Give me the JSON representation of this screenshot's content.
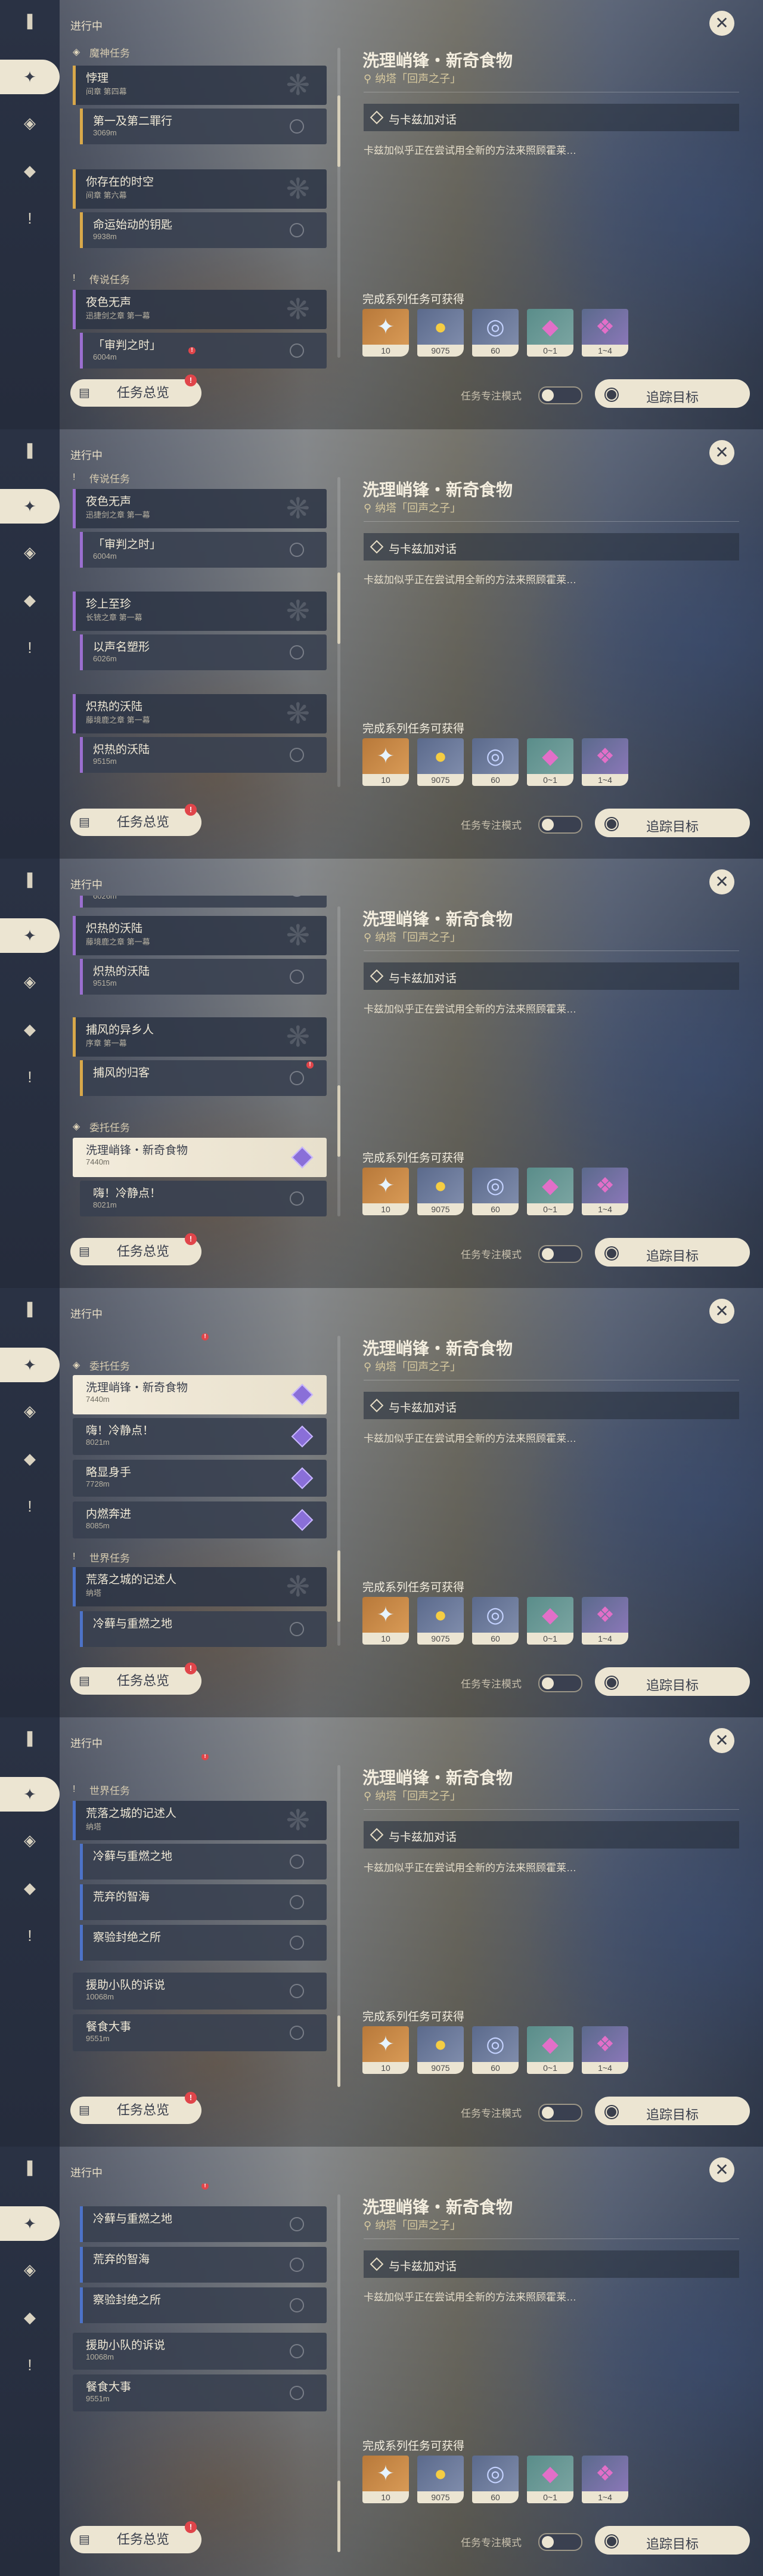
{
  "header": {
    "progress": "进行中"
  },
  "nav": {
    "icons": [
      "quest-book-icon",
      "elemental-diamond-icon",
      "inner-diamond-icon",
      "commission-diamond-icon",
      "exclamation-icon"
    ]
  },
  "categories": {
    "archon": "魔神任务",
    "story": "传说任务",
    "commission": "委托任务",
    "world": "世界任务"
  },
  "quests": {
    "q1": {
      "title": "悖理",
      "sub": "间章 第四幕"
    },
    "q2": {
      "title": "第一及第二罪行",
      "sub": "3069m"
    },
    "q3": {
      "title": "你存在的时空",
      "sub": "间章 第六幕"
    },
    "q4": {
      "title": "命运始动的钥匙",
      "sub": "9938m"
    },
    "q5": {
      "title": "夜色无声",
      "sub": "迅捷剑之章 第一幕"
    },
    "q6": {
      "title": "「审判之时」",
      "sub": "6004m"
    },
    "q7": {
      "title": "珍上至珍",
      "sub": "长铳之章 第一幕"
    },
    "q8": {
      "title": "以声名塑形",
      "sub": "6026m"
    },
    "q9": {
      "title": "炽热的沃陆",
      "sub": "藤境鹿之章 第一幕"
    },
    "q10": {
      "title": "炽热的沃陆",
      "sub": "9515m"
    },
    "q11": {
      "title": "捕风的异乡人",
      "sub": "序章 第一幕"
    },
    "q12": {
      "title": "捕风的归客",
      "sub": ""
    },
    "q13": {
      "title": "洗理峭锋・新奇食物",
      "sub": "7440m"
    },
    "q14": {
      "title": "嗨！冷静点！",
      "sub": "8021m"
    },
    "q15": {
      "title": "略显身手",
      "sub": "7728m"
    },
    "q16": {
      "title": "内燃奔进",
      "sub": "8085m"
    },
    "q17": {
      "title": "荒落之城的记述人",
      "sub": "纳塔"
    },
    "q18": {
      "title": "冷藓与重燃之地",
      "sub": ""
    },
    "q19": {
      "title": "荒弃的智海",
      "sub": ""
    },
    "q20": {
      "title": "察验封绝之所",
      "sub": ""
    },
    "q21": {
      "title": "援助小队的诉说",
      "sub": "10068m"
    },
    "q22": {
      "title": "餐食大事",
      "sub": "9551m"
    }
  },
  "detail": {
    "title": "洗理峭锋・新奇食物",
    "location": "纳塔「回声之子」",
    "objective": "与卡兹加对话",
    "description": "卡兹加似乎正在尝试用全新的方法来照顾霍莱…",
    "rewards_title": "完成系列任务可获得",
    "rewards": [
      {
        "icon": "starglitter-icon",
        "count": "10"
      },
      {
        "icon": "mora-coin-icon",
        "count": "9075"
      },
      {
        "icon": "exp-ring-icon",
        "count": "60"
      },
      {
        "icon": "crystal-icon",
        "count": "0~1"
      },
      {
        "icon": "crystal-cluster-icon",
        "count": "1~4"
      }
    ]
  },
  "footer": {
    "overview": "任务总览",
    "focus": "任务专注模式",
    "track": "追踪目标"
  },
  "colors": {
    "accent": "#ece5d2",
    "archon_bar": "#d8a84a",
    "story_bar": "#9b6fd0",
    "world_bar": "#4d73c8",
    "commission_gem": "#8a6fd8",
    "alert": "#e0454a"
  }
}
